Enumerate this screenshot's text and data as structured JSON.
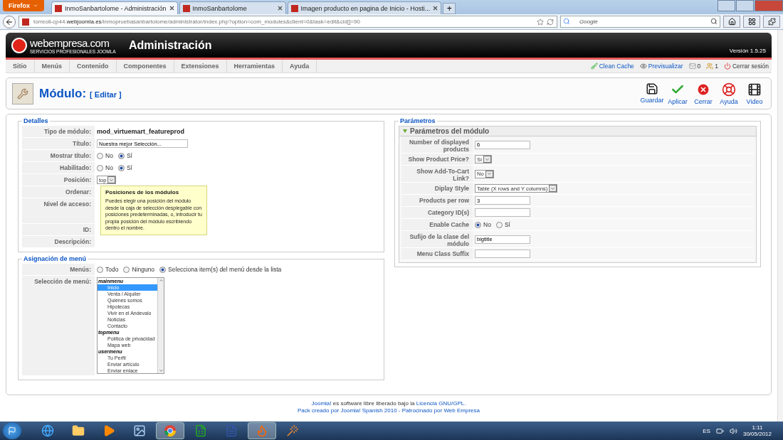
{
  "browser": {
    "menu_button": "Firefox",
    "tabs": [
      {
        "title": "InmoSanbartolome - Administración",
        "selected": true
      },
      {
        "title": "InmoSanbartolome",
        "selected": false
      },
      {
        "title": "Imagen producto en pagina de Inicio - Hosti...",
        "selected": false
      }
    ],
    "new_tab": "+",
    "url": "torreoli-cp44.**webjoomla.es**/inmopruebasanbartolome/administrator/index.php?option=com_modules&client=0&task=edit&cid[]=90",
    "search_placeholder": "Google"
  },
  "header": {
    "logo": "webempresa.com",
    "logo_tagline": "SERVICIOS PROFESIONALES JOOMLA",
    "title": "Administración",
    "version": "Versión 1.5.25"
  },
  "menu": [
    "Sitio",
    "Menús",
    "Contenido",
    "Componentes",
    "Extensiones",
    "Herramientas",
    "Ayuda"
  ],
  "status_links": [
    {
      "kind": "clean",
      "label": "Clean Cache"
    },
    {
      "kind": "preview",
      "label": "Previsualizar"
    },
    {
      "kind": "messages",
      "label": "0"
    },
    {
      "kind": "users",
      "label": "1"
    },
    {
      "kind": "logout",
      "label": "Cerrar sesión"
    }
  ],
  "toolbar": {
    "title": "Módulo:",
    "subtitle": "[ Editar ]",
    "buttons": [
      {
        "kind": "save",
        "label": "Guardar"
      },
      {
        "kind": "apply",
        "label": "Aplicar"
      },
      {
        "kind": "close",
        "label": "Cerrar"
      },
      {
        "kind": "help",
        "label": "Ayuda"
      },
      {
        "kind": "video",
        "label": "Video"
      }
    ]
  },
  "details": {
    "legend": "Detalles",
    "rows": [
      {
        "kind": "text",
        "label": "Tipo de módulo:",
        "value": "mod_virtuemart_featureprod"
      },
      {
        "kind": "input",
        "label": "Título:",
        "value": "Nuestra mejor Selección..."
      },
      {
        "kind": "radio",
        "label": "Mostrar título:",
        "options": [
          {
            "label": "No",
            "selected": false
          },
          {
            "label": "Sí",
            "selected": true
          }
        ]
      },
      {
        "kind": "radio",
        "label": "Habilitado:",
        "options": [
          {
            "label": "No",
            "selected": false
          },
          {
            "label": "Sí",
            "selected": true
          }
        ]
      },
      {
        "kind": "select",
        "label": "Posición:",
        "value": "top"
      },
      {
        "kind": "blank",
        "label": "Ordenar:"
      },
      {
        "kind": "tall",
        "label": "Nivel de acceso:"
      },
      {
        "kind": "blank",
        "label": "ID:"
      },
      {
        "kind": "blank",
        "label": "Descripción:"
      }
    ],
    "tooltip": {
      "title": "Posiciones de los módulos",
      "text": "Puedes elegir una posición del módulo desde la caja de selección desplegable con posiciones predeterminadas, o, introducir tu propia posición del módulo escribiendo dentro el nombre."
    }
  },
  "menu_assignment": {
    "legend": "Asignación de menú",
    "menus_label": "Menús:",
    "menus_options": [
      {
        "label": "Todo",
        "selected": false
      },
      {
        "label": "Ninguno",
        "selected": false
      },
      {
        "label": "Selecciona item(s) del menú desde la lista",
        "selected": true
      }
    ],
    "selection_label": "Selección de menú:",
    "list": [
      {
        "group": "mainmenu",
        "items": [
          {
            "label": "Inicio",
            "selected": true
          },
          {
            "label": "Venta / Alquiler",
            "selected": false
          },
          {
            "label": "Quiénes somos",
            "selected": false
          },
          {
            "label": "Hipotecas",
            "selected": false
          },
          {
            "label": "Vivir en el Andevalo",
            "selected": false
          },
          {
            "label": "Noticias",
            "selected": false
          },
          {
            "label": "Contacto",
            "selected": false
          }
        ]
      },
      {
        "group": "topmenu",
        "items": [
          {
            "label": "Política de privacidad",
            "selected": false
          },
          {
            "label": "Mapa web",
            "selected": false
          }
        ]
      },
      {
        "group": "usermenu",
        "items": [
          {
            "label": "Tu Perfil",
            "selected": false
          },
          {
            "label": "Enviar artículo",
            "selected": false
          },
          {
            "label": "Enviar enlace",
            "selected": false
          }
        ]
      }
    ]
  },
  "parameters": {
    "legend": "Parámetros",
    "panel_title": "Parámetros del módulo",
    "expanded": true,
    "rows": [
      {
        "kind": "input",
        "label": "Number of displayed products",
        "value": "6"
      },
      {
        "kind": "select",
        "label": "Show Product Price?",
        "value": "Sí"
      },
      {
        "kind": "select",
        "label": "Show Add-To-Cart Link?",
        "value": "No"
      },
      {
        "kind": "select",
        "label": "Diplay Style",
        "value": "Table (X rows and Y columns)"
      },
      {
        "kind": "input",
        "label": "Products per row",
        "value": "3"
      },
      {
        "kind": "input",
        "label": "Category ID(s)",
        "value": ""
      },
      {
        "kind": "radio",
        "label": "Enable Cache",
        "options": [
          {
            "label": "No",
            "selected": true
          },
          {
            "label": "Sí",
            "selected": false
          }
        ]
      },
      {
        "kind": "input",
        "label": "Sufijo de la clase del módulo",
        "value": "bigtitle"
      },
      {
        "kind": "input",
        "label": "Menu Class Suffix",
        "value": ""
      }
    ]
  },
  "footer": {
    "line1": [
      {
        "text": "Joomla!",
        "kind": "link"
      },
      {
        "text": "es software libre liberado bajo la",
        "kind": "text"
      },
      {
        "text": "Licencia GNU/GPL.",
        "kind": "link"
      }
    ],
    "line2": "Pack creado por Joomla! Spanish 2010 - Patrocinado por Web Empresa"
  },
  "taskbar": {
    "apps": [
      {
        "kind": "ie",
        "selected": false
      },
      {
        "kind": "folder",
        "selected": false
      },
      {
        "kind": "media",
        "selected": false
      },
      {
        "kind": "image",
        "selected": false
      },
      {
        "kind": "chrome",
        "selected": true
      },
      {
        "kind": "excel",
        "selected": false
      },
      {
        "kind": "word",
        "selected": false
      },
      {
        "kind": "firefox",
        "selected": true
      },
      {
        "kind": "tool",
        "selected": false
      }
    ],
    "language": "ES",
    "time": "1:11",
    "date": "30/05/2012"
  }
}
